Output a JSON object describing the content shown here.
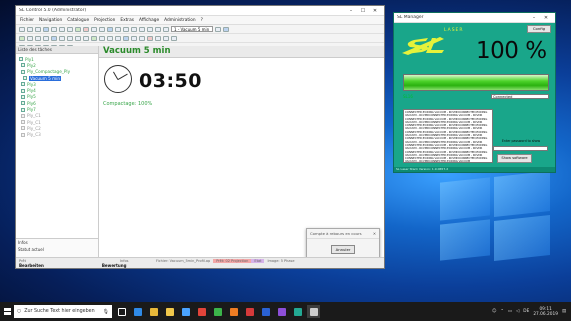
{
  "main_window": {
    "title": "SL Control 5.0 (Administrator)",
    "menu": [
      "Fichier",
      "Navigation",
      "Catalogue",
      "Projection",
      "Extras",
      "Affichage",
      "Administration",
      "?"
    ],
    "project_select": "1 - Vacuum 5 min",
    "left_panel": {
      "header": "Liste des tâches",
      "items": [
        {
          "label": "Ply1",
          "state": "done"
        },
        {
          "label": "Ply2",
          "state": "done"
        },
        {
          "label": "Ply_Compactage_Ply",
          "state": "done"
        },
        {
          "label": "Vacuum 5 min",
          "state": "selected"
        },
        {
          "label": "Ply3",
          "state": "done"
        },
        {
          "label": "Ply4",
          "state": "done"
        },
        {
          "label": "Ply5",
          "state": "done"
        },
        {
          "label": "Ply6",
          "state": "done"
        },
        {
          "label": "Ply7",
          "state": "done"
        },
        {
          "label": "Ply_C1",
          "state": "pending"
        },
        {
          "label": "Ply_C1",
          "state": "pending"
        },
        {
          "label": "Ply_C2",
          "state": "pending"
        },
        {
          "label": "Ply_C3",
          "state": "pending"
        }
      ],
      "bottom_label": "Infos",
      "bottom_value": "Statut actuel"
    },
    "main": {
      "heading": "Vacuum 5 min",
      "timer": "03:50",
      "compactage": "Compactage: 100%"
    },
    "dialog": {
      "title": "Compte à rebours en cours",
      "button": "Annuler"
    },
    "status_cells": [
      {
        "text": "Prêt",
        "style": "plain"
      },
      {
        "text": "Infos",
        "style": "plain"
      },
      {
        "text": "Fichier: Vacuum_5min_Profil.ap",
        "style": "plain"
      },
      {
        "text": "Prêt: 02 Projection",
        "style": "red"
      },
      {
        "text": "Etat",
        "style": "purple"
      },
      {
        "text": "Image: 5 Phase",
        "style": "plain"
      }
    ],
    "status_columns": [
      "Bearbeiten",
      "Bewertung"
    ]
  },
  "sl_window": {
    "title": "SL Manager",
    "logo_text": "LASER",
    "config_button": "Config",
    "percent": "100 %",
    "progress": 1.0,
    "row_label": "SL16",
    "row_value": "Connected",
    "log_lines": [
      "CONNECTED;EODING VACUUM - RCVMDCONNECTED;EODING",
      "VACUUM - RCVMDCONNECTED;EODING VACUUM - RCVDR",
      "CONNECTED;EODING VACUUM - RCVMDCONNECTED;EODING",
      "VACUUM - RCVMDCONNECTED;EODING VACUUM - RCVDR",
      "CONNECTED;EODING VACUUM - RCVMDCONNECTED;EODING",
      "VACUUM - RCVMDCONNECTED;EODING VACUUM - RCVDR",
      "CONNECTED;EODING VACUUM - RCVMDCONNECTED;EODING",
      "VACUUM - RCVMDCONNECTED;EODING VACUUM - RCVDR",
      "CONNECTED;EODING VACUUM - RCVMDCONNECTED;EODING",
      "VACUUM - RCVMDCONNECTED;EODING VACUUM - RCVDR",
      "CONNECTED;EODING VACUUM - RCVMDCONNECTED;EODING",
      "VACUUM - RCVMDCONNECTED;EODING VACUUM - RCVDR",
      "CONNECTED;EODING VACUUM - RCVMDCONNECTED;EODING",
      "VACUUM - RCVMDCONNECTED;EODING VACUUM - RCVDR",
      "CONNECTED;EODING VACUUM - RCVMDCONNECTED;EODING",
      "VACUUM - RCVMDCONNECTED;EODING VACUUM"
    ],
    "entry_label": "Enter password to show",
    "show_button": "Show software",
    "status": "SL Laser Stack Version: 1.9.0657.2"
  },
  "taskbar": {
    "search_placeholder": "Zur Suche Text hier eingeben",
    "apps": [
      {
        "icon": "task-view-icon",
        "color": "#ffffff"
      },
      {
        "icon": "edge-icon",
        "color": "#2f8ae6"
      },
      {
        "icon": "chrome-icon",
        "color": "#e8b83a"
      },
      {
        "icon": "explorer-icon",
        "color": "#f1c84b"
      },
      {
        "icon": "store-icon",
        "color": "#4aa3ff"
      },
      {
        "icon": "app-red-icon",
        "color": "#e2443a"
      },
      {
        "icon": "app-green-icon",
        "color": "#3bb54a"
      },
      {
        "icon": "app-orange-icon",
        "color": "#ef7d23"
      },
      {
        "icon": "app-red2-icon",
        "color": "#d63a3a"
      },
      {
        "icon": "app-blue-icon",
        "color": "#2a62d4"
      },
      {
        "icon": "app-purple-icon",
        "color": "#8d4fd8"
      },
      {
        "icon": "app-teal-icon",
        "color": "#23a993"
      },
      {
        "icon": "app-active-icon",
        "color": "#cccccc"
      }
    ],
    "time": "09:11",
    "date": "27.06.2019"
  }
}
